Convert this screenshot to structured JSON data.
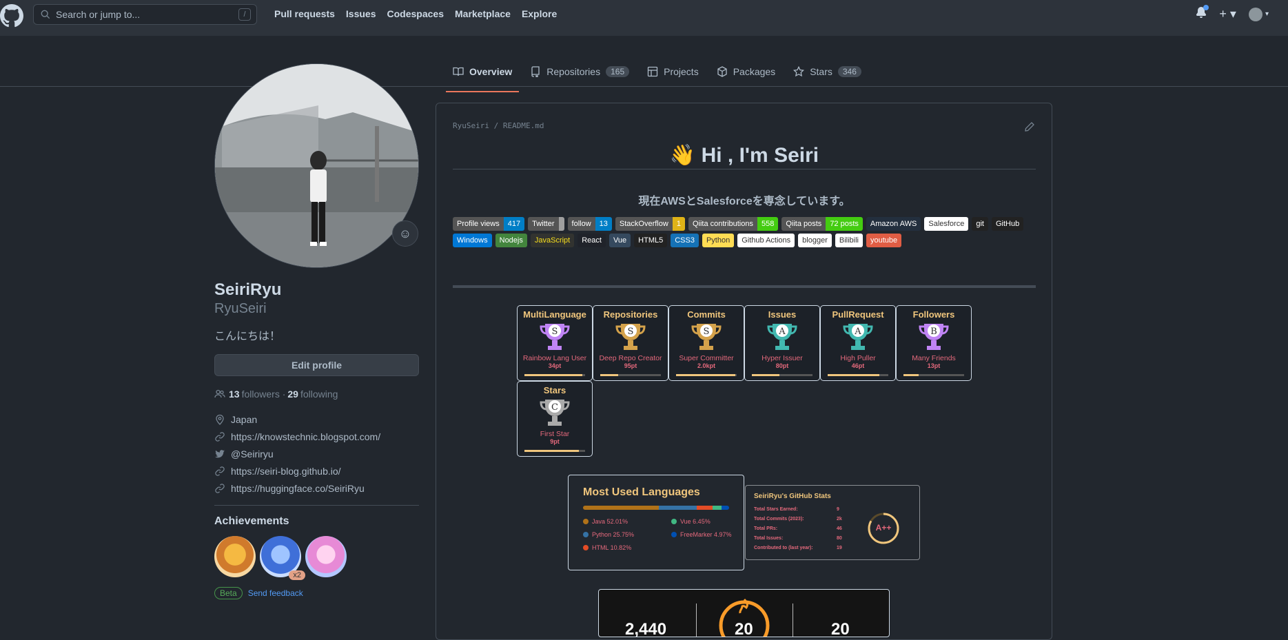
{
  "header": {
    "search_placeholder": "Search or jump to...",
    "slash": "/",
    "nav": [
      "Pull requests",
      "Issues",
      "Codespaces",
      "Marketplace",
      "Explore"
    ]
  },
  "tabs": [
    {
      "label": "Overview"
    },
    {
      "label": "Repositories",
      "count": "165"
    },
    {
      "label": "Projects"
    },
    {
      "label": "Packages"
    },
    {
      "label": "Stars",
      "count": "346"
    }
  ],
  "profile": {
    "name": "SeiriRyu",
    "login": "RyuSeiri",
    "bio": "こんにちは！",
    "edit_label": "Edit profile",
    "followers": "13",
    "followers_label": "followers",
    "dot": "·",
    "following": "29",
    "following_label": "following",
    "location": "Japan",
    "links": [
      "https://knowstechnic.blogspot.com/",
      "@Seiriryu",
      "https://seiri-blog.github.io/",
      "https://huggingface.co/SeiriRyu"
    ],
    "achievements_title": "Achievements",
    "achievement_count": "x2",
    "beta": "Beta",
    "feedback": "Send feedback"
  },
  "readme": {
    "path_user": "RyuSeiri",
    "path_sep": "/",
    "path_file": "README.md",
    "title": "👋 Hi , I'm Seiri",
    "subtitle": "現在AWSとSalesforceを専念しています。",
    "shields": [
      {
        "l": "Profile views",
        "r": "417",
        "lc": "#555555",
        "rc": "#007ec6"
      },
      {
        "l": "Twitter",
        "r": "",
        "lc": "#555555",
        "rc": "#9f9f9f"
      },
      {
        "l": "follow",
        "r": "13",
        "lc": "#555555",
        "rc": "#007ec6"
      },
      {
        "l": "StackOverflow",
        "r": "1",
        "lc": "#555555",
        "rc": "#dfb317"
      },
      {
        "l": "Qiita contributions",
        "r": "558",
        "lc": "#555555",
        "rc": "#4c1"
      },
      {
        "l": "Qiita posts",
        "r": "72 posts",
        "lc": "#555555",
        "rc": "#4c1"
      },
      {
        "l": "Amazon AWS",
        "r": "",
        "lc": "#232f3e",
        "rc": "#232f3e"
      },
      {
        "l": "Salesforce",
        "r": "",
        "lc": "#ffffff",
        "rc": "#ffffff",
        "dark": true
      },
      {
        "l": "git",
        "r": "",
        "lc": "#222222",
        "rc": "#222222"
      },
      {
        "l": "GitHub",
        "r": "",
        "lc": "#222222",
        "rc": "#222222"
      },
      {
        "l": "Windows",
        "r": "",
        "lc": "#0078d6",
        "rc": "#0078d6"
      },
      {
        "l": "Nodejs",
        "r": "",
        "lc": "#43853d",
        "rc": "#43853d"
      },
      {
        "l": "JavaScript",
        "r": "",
        "lc": "#323330",
        "rc": "#323330",
        "yellow": true
      },
      {
        "l": "React",
        "r": "",
        "lc": "#20232a",
        "rc": "#20232a"
      },
      {
        "l": "Vue",
        "r": "",
        "lc": "#35495e",
        "rc": "#35495e"
      },
      {
        "l": "HTML5",
        "r": "",
        "lc": "#222222",
        "rc": "#222222"
      },
      {
        "l": "CSS3",
        "r": "",
        "lc": "#1572b6",
        "rc": "#1572b6"
      },
      {
        "l": "Python",
        "r": "",
        "lc": "#ffdd54",
        "rc": "#ffdd54",
        "dark": true
      },
      {
        "l": "Github Actions",
        "r": "",
        "lc": "#ffffff",
        "rc": "#ffffff",
        "dark": true
      },
      {
        "l": "blogger",
        "r": "",
        "lc": "#ffffff",
        "rc": "#ffffff",
        "dark": true
      },
      {
        "l": "Bilibili",
        "r": "",
        "lc": "#ffffff",
        "rc": "#ffffff",
        "dark": true
      },
      {
        "l": "youtube",
        "r": "",
        "lc": "#e05d44",
        "rc": "#e05d44"
      }
    ],
    "trophies": [
      {
        "title": "MultiLanguage",
        "rank": "S",
        "name": "Rainbow Lang User",
        "pt": "34pt",
        "fill": 0.95,
        "color": "#c084f5"
      },
      {
        "title": "Repositories",
        "rank": "S",
        "name": "Deep Repo Creator",
        "pt": "95pt",
        "fill": 0.3,
        "color": "#d4a24b"
      },
      {
        "title": "Commits",
        "rank": "S",
        "name": "Super Committer",
        "pt": "2.0kpt",
        "fill": 0.98,
        "color": "#d4a24b"
      },
      {
        "title": "Issues",
        "rank": "A",
        "name": "Hyper Issuer",
        "pt": "80pt",
        "fill": 0.45,
        "color": "#42b8b0"
      },
      {
        "title": "PullRequest",
        "rank": "A",
        "name": "High Puller",
        "pt": "46pt",
        "fill": 0.85,
        "color": "#42b8b0"
      },
      {
        "title": "Followers",
        "rank": "B",
        "name": "Many Friends",
        "pt": "13pt",
        "fill": 0.25,
        "color": "#c084f5"
      },
      {
        "title": "Stars",
        "rank": "C",
        "name": "First Star",
        "pt": "9pt",
        "fill": 0.9,
        "color": "#aaaaaa"
      }
    ],
    "languages": {
      "title": "Most Used Languages",
      "items": [
        {
          "name": "Java 52.01%",
          "pct": 52.01,
          "color": "#b07219"
        },
        {
          "name": "Python 25.75%",
          "pct": 25.75,
          "color": "#3572A5"
        },
        {
          "name": "HTML 10.82%",
          "pct": 10.82,
          "color": "#e34c26"
        },
        {
          "name": "Vue 6.45%",
          "pct": 6.45,
          "color": "#41b883"
        },
        {
          "name": "FreeMarker 4.97%",
          "pct": 4.97,
          "color": "#0050b2"
        }
      ]
    },
    "stats": {
      "title": "SeiriRyu's GitHub Stats",
      "rows": [
        {
          "k": "Total Stars Earned:",
          "v": "9"
        },
        {
          "k": "Total Commits (2023):",
          "v": "2k"
        },
        {
          "k": "Total PRs:",
          "v": "46"
        },
        {
          "k": "Total Issues:",
          "v": "80"
        },
        {
          "k": "Contributed to (last year):",
          "v": "19"
        }
      ],
      "grade": "A++"
    },
    "streak": {
      "left": "2,440",
      "mid": "20",
      "right": "20"
    }
  }
}
